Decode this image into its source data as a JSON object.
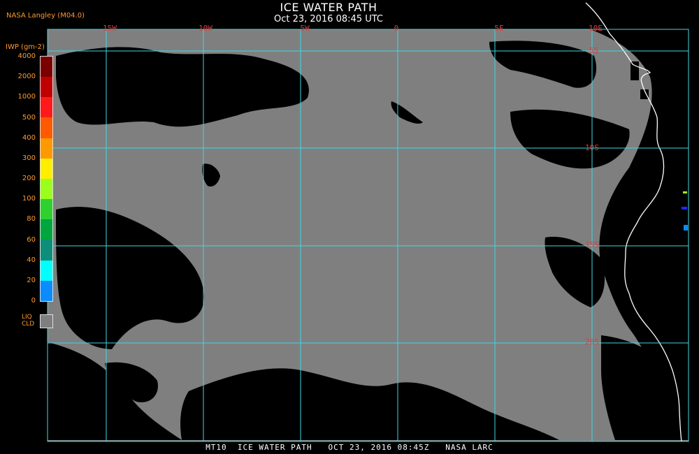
{
  "header": {
    "title": "ICE WATER PATH",
    "subtitle": "Oct 23, 2016 08:45 UTC",
    "agency": "NASA Langley (M04.0)"
  },
  "grid": {
    "lon_labels": [
      "15W",
      "10W",
      "5W",
      "0",
      "5E",
      "10E"
    ],
    "lat_labels": [
      "5S",
      "10S",
      "15S",
      "20S"
    ]
  },
  "legend": {
    "title": "IWP (gm-2)",
    "labels": [
      "4000",
      "2000",
      "1000",
      "500",
      "400",
      "300",
      "200",
      "100",
      "80",
      "60",
      "40",
      "20",
      "0"
    ],
    "colors": [
      "#7a0000",
      "#c00000",
      "#ff1a1a",
      "#ff5a00",
      "#ff9900",
      "#ffee00",
      "#9aff1a",
      "#2fd12f",
      "#00a63e",
      "#0c8f7a",
      "#00ffff",
      "#0a8cff",
      "#1e28ff",
      "#2a00ff",
      "#8a2fe0"
    ],
    "liq_label": "LIQ CLD",
    "liq_color": "#7f7f7f"
  },
  "colors": {
    "land_background": "#000000",
    "cloud": "#7f7f7f",
    "grid": "#3fd7e6",
    "coastline": "#ffffff",
    "label": "#e23a3a"
  },
  "footer": {
    "text": "MT10  ICE WATER PATH   OCT 23, 2016 08:45Z   NASA LARC"
  }
}
